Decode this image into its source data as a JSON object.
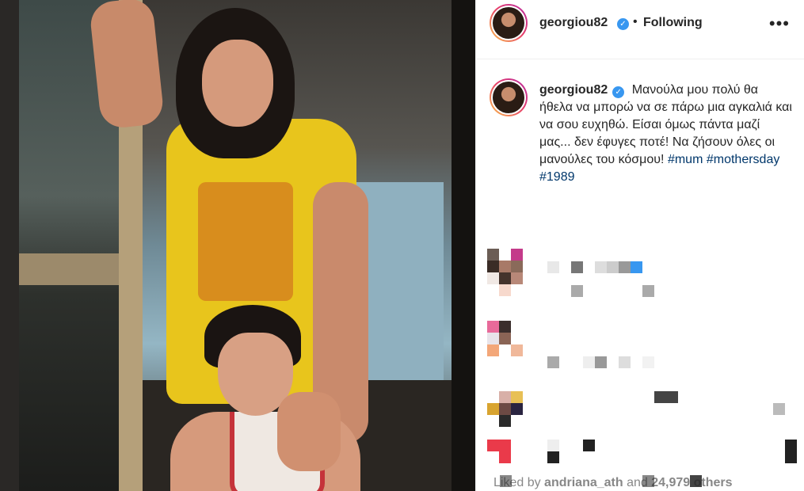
{
  "post": {
    "username": "georgiou82",
    "follow_status": "Following",
    "more_label": "•••",
    "verified_icon": "✓",
    "caption_text": "Μανούλα μου πολύ θα ήθελα να μπορώ να σε πάρω μια αγκαλιά και να σου ευχηθώ. Είσαι όμως πάντα μαζί μας... δεν έφυγες ποτέ! Να ζήσουν όλες οι μανούλες του κόσμου!",
    "hashtags": [
      "#mum",
      "#mothersday",
      "#1989"
    ],
    "liked_prefix": "Liked by",
    "liked_user": "andriana_ath",
    "liked_and": "and",
    "liked_count": "24,979 others",
    "separator": "•"
  },
  "colors": {
    "verified": "#3897f0",
    "hashtag": "#00376b",
    "text": "#262626"
  }
}
